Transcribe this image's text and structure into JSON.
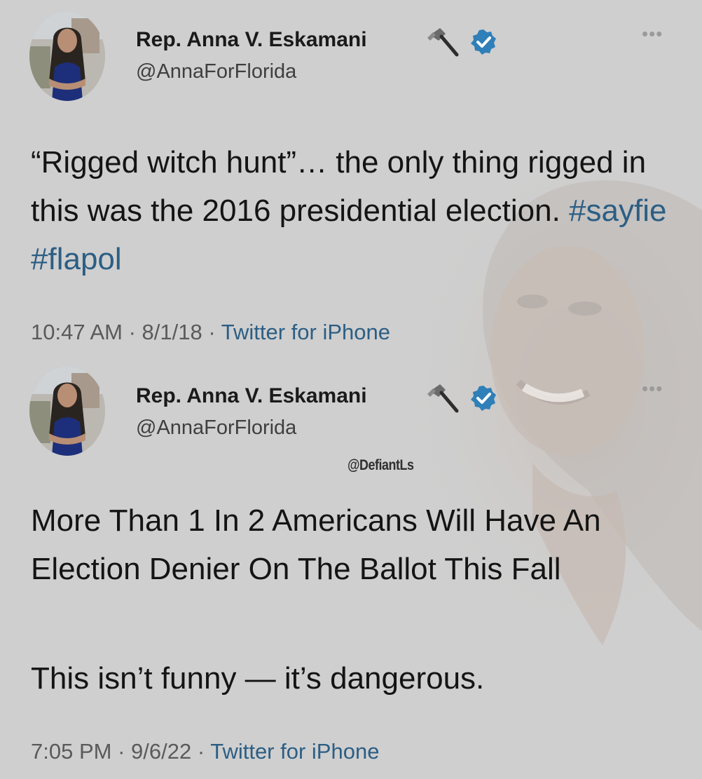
{
  "tweets": [
    {
      "display_name": "Rep. Anna V. Eskamani",
      "handle": "@AnnaForFlorida",
      "name_emoji_icon": "hammer-icon",
      "verified_icon": "verified-badge-icon",
      "more_label": "•••",
      "text_before_tags": "“Rigged witch hunt”… the only thing rigged in this was the 2016  presidential election. ",
      "hashtag_1": "#sayfie",
      "hashtag_2": "#flapol",
      "time": "10:47 AM",
      "date": "8/1/18",
      "source": "Twitter for iPhone",
      "separator": " · "
    },
    {
      "display_name": "Rep. Anna V. Eskamani",
      "handle": "@AnnaForFlorida",
      "name_emoji_icon": "hammer-icon",
      "verified_icon": "verified-badge-icon",
      "more_label": "•••",
      "watermark": "@DefiantLs",
      "paragraph_1": "More Than 1 In 2 Americans Will Have An Election Denier On The Ballot This Fall",
      "paragraph_2": "This isn’t funny — it’s dangerous.",
      "time": "7:05 PM",
      "date": "9/6/22",
      "source": "Twitter for iPhone",
      "separator": " · "
    }
  ],
  "colors": {
    "background": "#cfcfcf",
    "text": "#141414",
    "secondary_text": "#5a5a5a",
    "link": "#2c5e84",
    "verified": "#2f7fb8"
  }
}
